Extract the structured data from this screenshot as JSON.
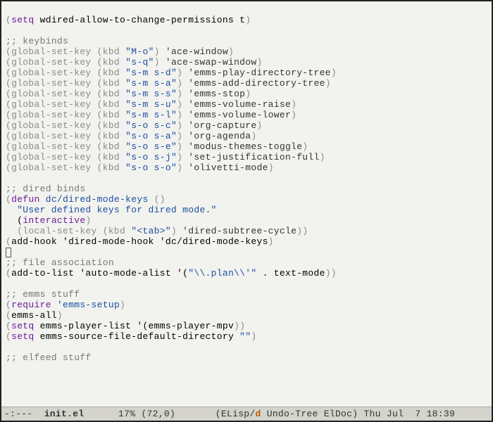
{
  "code": {
    "line01_pre": "(",
    "line01_kw": "setq",
    "line01_a": " wdired-allow-to-change-permissions t",
    "line01_post": ")",
    "blank": "",
    "c_keybinds": ";; keybinds",
    "gsk_pre": "(global-set-key ",
    "gsk_kbd": "(kbd ",
    "gsk_mid": ") ",
    "gsk_end": ")",
    "k1_key": "\"M-o\"",
    "k1_cmd": "'ace-window",
    "k2_key": "\"s-q\"",
    "k2_cmd": "'ace-swap-window",
    "k3_key": "\"s-m s-d\"",
    "k3_cmd": "'emms-play-directory-tree",
    "k4_key": "\"s-m s-a\"",
    "k4_cmd": "'emms-add-directory-tree",
    "k5_key": "\"s-m s-s\"",
    "k5_cmd": "'emms-stop",
    "k6_key": "\"s-m s-u\"",
    "k6_cmd": "'emms-volume-raise",
    "k7_key": "\"s-m s-l\"",
    "k7_cmd": "'emms-volume-lower",
    "k8_key": "\"s-o s-c\"",
    "k8_cmd": "'org-capture",
    "k9_key": "\"s-o s-a\"",
    "k9_cmd": "'org-agenda",
    "k10_key": "\"s-o s-e\"",
    "k10_cmd": "'modus-themes-toggle",
    "k11_key": "\"s-o s-j\"",
    "k11_cmd": "'set-justification-full",
    "k12_key": "\"s-o s-o\"",
    "k12_cmd": "'olivetti-mode",
    "c_dired": ";; dired binds",
    "defun_pre": "(",
    "defun_kw": "defun",
    "defun_name": " dc/dired-mode-keys",
    "defun_args": " ()",
    "docstr_pre": "  ",
    "docstr": "\"User defined keys for dired mode.\"",
    "inter_pre": "  (",
    "inter_kw": "interactive",
    "inter_post": ")",
    "lsk_pre": "  (local-set-key (kbd ",
    "lsk_key": "\"<tab>\"",
    "lsk_cmd": "'dired-subtree-cycle",
    "lsk_close": "))",
    "hook_open": "(",
    "hook_body": "add-hook 'dired-mode-hook 'dc/dired-mode-keys",
    "hook_close": ")",
    "c_fileassoc": ";; file association",
    "atl_open": "(",
    "atl_body1": "add-to-list 'auto-mode-alist '(",
    "atl_str": "\"\\\\.plan\\\\'\"",
    "atl_body2": " . text-mode",
    "atl_close": "))",
    "c_emms": ";; emms stuff",
    "req_open": "(",
    "req_kw": "require",
    "req_sym": " 'emms-setup",
    "req_close": ")",
    "emmsall_open": "(",
    "emmsall_body": "emms-all",
    "emmsall_close": ")",
    "setq_pl_open": "(",
    "setq_pl_kw": "setq",
    "setq_pl_body": " emms-player-list '(emms-player-mpv",
    "setq_pl_close": "))",
    "setq_dd_open": "(",
    "setq_dd_kw": "setq",
    "setq_dd_body": " emms-source-file-default-directory ",
    "setq_dd_str": "\"\"",
    "setq_dd_close": ")",
    "c_elfeed": ";; elfeed stuff"
  },
  "modeline": {
    "left": "-:--- ",
    "buffer": " init.el ",
    "pad1": "     ",
    "percent": "17%",
    "pos": " (72,0)",
    "pad2": "       ",
    "modes_pre": "(ELisp/",
    "dirty": "d",
    "modes_post": " Undo-Tree ElDoc)",
    "time": " Thu Jul  7 18:39"
  }
}
